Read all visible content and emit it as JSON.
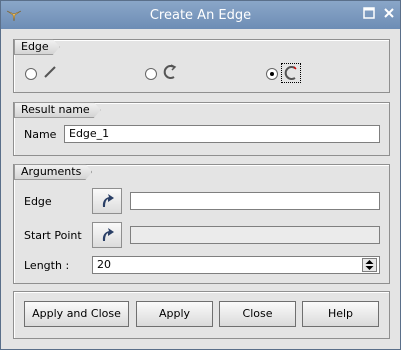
{
  "window": {
    "title": "Create An Edge"
  },
  "edge_group": {
    "label": "Edge",
    "options": [
      {
        "name": "line",
        "selected": false
      },
      {
        "name": "arc",
        "selected": false
      },
      {
        "name": "curve",
        "selected": true
      }
    ]
  },
  "result_group": {
    "label": "Result name",
    "name_label": "Name",
    "name_value": "Edge_1"
  },
  "arguments_group": {
    "label": "Arguments",
    "edge_label": "Edge",
    "edge_value": "",
    "start_point_label": "Start Point",
    "start_point_value": "",
    "length_label": "Length :",
    "length_value": "20"
  },
  "buttons": {
    "apply_close": "Apply and Close",
    "apply": "Apply",
    "close": "Close",
    "help": "Help"
  },
  "colors": {
    "titlebar": "#7896bd",
    "background": "#e4e4e4"
  }
}
